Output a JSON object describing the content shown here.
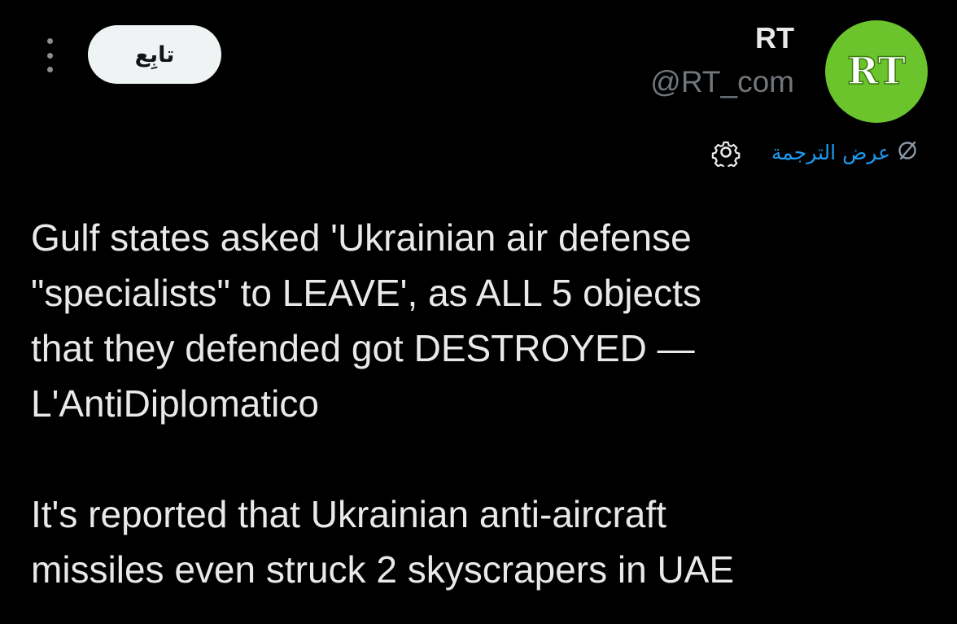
{
  "header": {
    "follow_label": "تابِع",
    "author_name": "RT",
    "author_handle": "@RT_com",
    "avatar_text": "RT",
    "avatar_color": "#6bc42b"
  },
  "translate": {
    "label": "عرض الترجمة",
    "link_color": "#1d9bf0"
  },
  "icons": {
    "more": "more-vertical-icon",
    "translate": "translate-globe-icon",
    "settings": "gear-icon"
  },
  "tweet": {
    "paragraph1": "Gulf states asked 'Ukrainian air defense\n\"specialists\" to LEAVE', as ALL 5 objects\nthat they defended got DESTROYED —\nL'AntiDiplomatico",
    "paragraph2": "It's reported that Ukrainian anti-aircraft\nmissiles even struck 2 skyscrapers in UAE"
  },
  "theme": {
    "background": "#000000",
    "text": "#e7e9ea",
    "secondary": "#71767b"
  }
}
